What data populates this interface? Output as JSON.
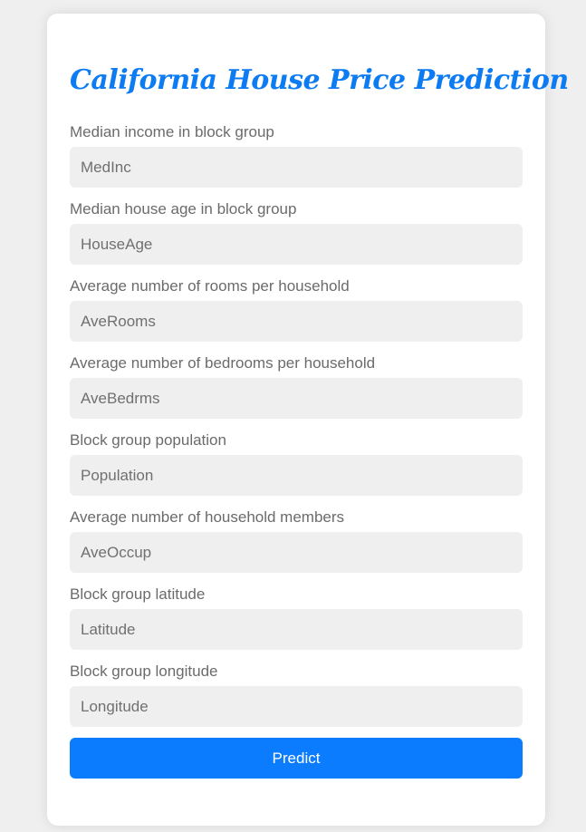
{
  "page": {
    "title": "California House Price Prediction"
  },
  "form": {
    "fields": [
      {
        "label": "Median income in block group",
        "placeholder": "MedInc",
        "value": ""
      },
      {
        "label": "Median house age in block group",
        "placeholder": "HouseAge",
        "value": ""
      },
      {
        "label": "Average number of rooms per household",
        "placeholder": "AveRooms",
        "value": ""
      },
      {
        "label": "Average number of bedrooms per household",
        "placeholder": "AveBedrms",
        "value": ""
      },
      {
        "label": "Block group population",
        "placeholder": "Population",
        "value": ""
      },
      {
        "label": "Average number of household members",
        "placeholder": "AveOccup",
        "value": ""
      },
      {
        "label": "Block group latitude",
        "placeholder": "Latitude",
        "value": ""
      },
      {
        "label": "Block group longitude",
        "placeholder": "Longitude",
        "value": ""
      }
    ],
    "submit_label": "Predict"
  },
  "colors": {
    "accent": "#0a7cfd",
    "title": "#0d7bf2",
    "background": "#efefef",
    "card": "#ffffff",
    "input_bg": "#efefef",
    "label": "#6b6b6b"
  }
}
